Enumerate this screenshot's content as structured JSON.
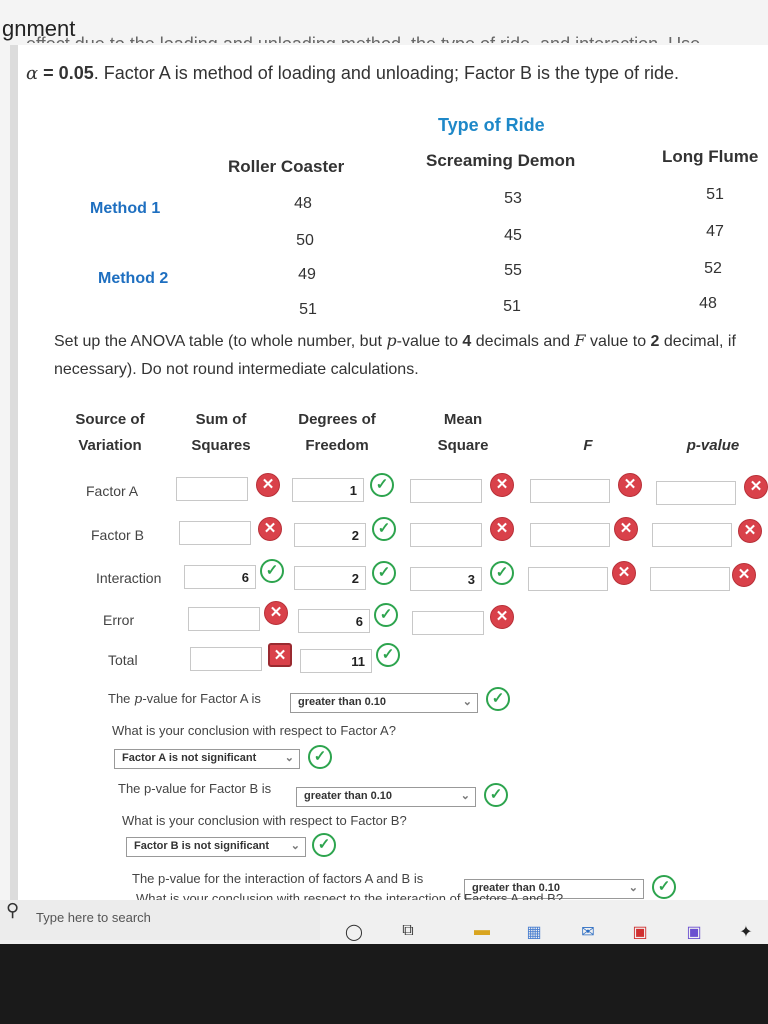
{
  "header": {
    "heading": "gnment"
  },
  "problem": {
    "cut_line": "effect due to the loading and unloading method, the type of ride, and interaction. Use",
    "alpha_symbol": "α",
    "alpha_value": "= 0.05",
    "text": ". Factor A is method of loading and unloading; Factor B is the type of ride."
  },
  "data_table": {
    "heading": "Type of Ride",
    "columns": [
      "Roller Coaster",
      "Screaming Demon",
      "Long Flume"
    ],
    "row_labels": [
      "Method 1",
      "Method 2"
    ],
    "values": [
      [
        "48",
        "53",
        "51"
      ],
      [
        "50",
        "45",
        "47"
      ],
      [
        "49",
        "55",
        "52"
      ],
      [
        "51",
        "51",
        "48"
      ]
    ]
  },
  "instructions": {
    "part1": "Set up the ANOVA table (to whole number, but ",
    "pvar": "p",
    "part2": "-value to ",
    "n4": "4",
    "part3": " decimals and ",
    "fvar": "F",
    "part4": " value to ",
    "n2": "2",
    "part5": " decimal, if necessary). Do not round intermediate calculations."
  },
  "anova": {
    "headers": {
      "source": [
        "Source of",
        "Variation"
      ],
      "ss": [
        "Sum of",
        "Squares"
      ],
      "df": [
        "Degrees of",
        "Freedom"
      ],
      "ms": [
        "Mean",
        "Square"
      ],
      "f": "F",
      "p": "p-value"
    },
    "rows": [
      {
        "label": "Factor A",
        "ss": "",
        "df": "1",
        "ms": "",
        "f": "",
        "p": ""
      },
      {
        "label": "Factor B",
        "ss": "",
        "df": "2",
        "ms": "",
        "f": "",
        "p": ""
      },
      {
        "label": "Interaction",
        "ss": "6",
        "df": "2",
        "ms": "3",
        "f": "",
        "p": ""
      },
      {
        "label": "Error",
        "ss": "",
        "df": "6",
        "ms": ""
      },
      {
        "label": "Total",
        "ss": "",
        "df": "11"
      }
    ]
  },
  "questions": {
    "q1_pre": "The ",
    "q1_var": "p",
    "q1_post": "-value for Factor A is",
    "q1_answer": "greater than 0.10",
    "q2": "What is your conclusion with respect to Factor A?",
    "q2_answer": "Factor A is not significant",
    "q3": "The p-value for Factor B is",
    "q3_answer": "greater than 0.10",
    "q4": "What is your conclusion with respect to Factor B?",
    "q4_answer": "Factor B is not significant",
    "q5": "The p-value for the interaction of factors A and B is",
    "q5_answer": "greater than 0.10",
    "q6": "What is your conclusion with respect to the interaction of Factors A and B?"
  },
  "taskbar": {
    "search_placeholder": "Type here to search"
  },
  "colors": {
    "accent": "#1e88c8",
    "correct": "#2da44e",
    "incorrect": "#d9414a"
  }
}
